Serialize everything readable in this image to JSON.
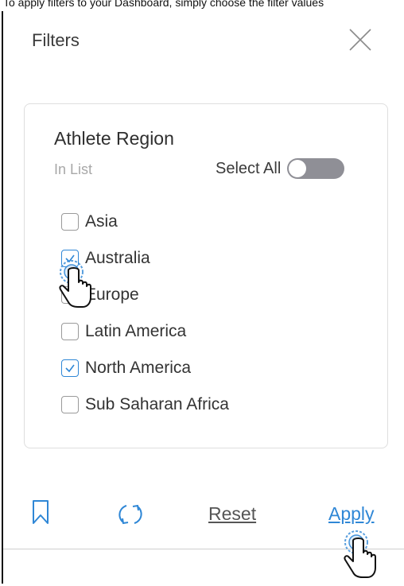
{
  "caption": "To apply filters to your Dashboard, simply choose the filter values",
  "panel": {
    "title": "Filters",
    "close_icon": "close-icon"
  },
  "filter": {
    "name": "Athlete Region",
    "mode": "In List",
    "select_all_label": "Select All",
    "select_all_on": false,
    "options": [
      {
        "label": "Asia",
        "checked": false
      },
      {
        "label": "Australia",
        "checked": true
      },
      {
        "label": "Europe",
        "checked": false
      },
      {
        "label": "Latin America",
        "checked": false
      },
      {
        "label": "North America",
        "checked": true
      },
      {
        "label": "Sub Saharan Africa",
        "checked": false
      }
    ]
  },
  "footer": {
    "bookmark_icon": "bookmark-icon",
    "refresh_icon": "refresh-icon",
    "reset_label": "Reset",
    "apply_label": "Apply"
  },
  "colors": {
    "accent": "#2f87d6",
    "toggle_off": "#8f8f96",
    "text": "#333333"
  }
}
